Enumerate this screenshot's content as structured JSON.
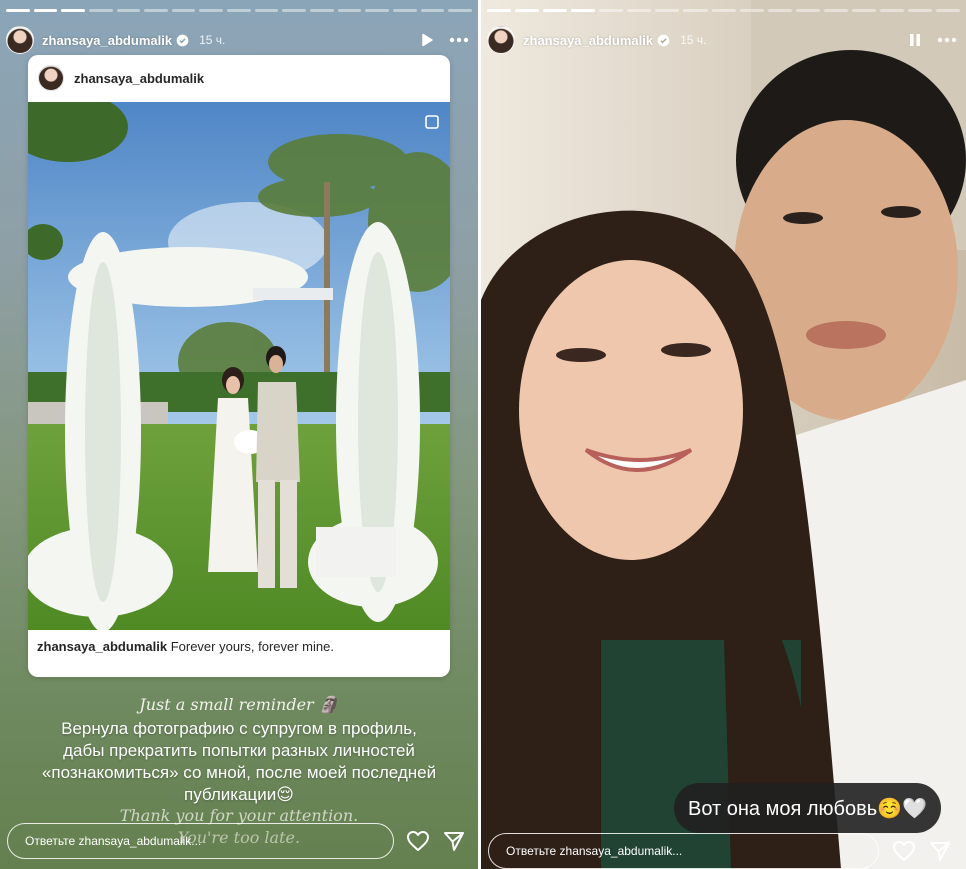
{
  "left_story": {
    "progress": {
      "segments": 17,
      "completed": 3
    },
    "header": {
      "username": "zhansaya_abdumalik",
      "time": "15 ч.",
      "play_icon": "play-icon",
      "more_icon": "more-icon"
    },
    "post": {
      "username": "zhansaya_abdumalik",
      "caption_username": "zhansaya_abdumalik",
      "caption_text": "Forever yours, forever mine."
    },
    "text": {
      "script_top": "Just a small reminder 🗿",
      "lines": [
        "Вернула фотографию с супругом в профиль,",
        "дабы прекратить попытки разных личностей",
        "«познакомиться» со мной, после моей последней",
        "публикации😌"
      ],
      "script_bottom_1": "Thank you for your attention.",
      "script_bottom_2": "You're too late."
    },
    "reply_placeholder": "Ответьте zhansaya_abdumalik..."
  },
  "right_story": {
    "progress": {
      "segments": 17,
      "completed": 4
    },
    "header": {
      "username": "zhansaya_abdumalik",
      "time": "15 ч.",
      "pause_icon": "pause-icon",
      "more_icon": "more-icon"
    },
    "sticker_text": "Вот она моя любовь☺️🤍",
    "reply_placeholder": "Ответьте zhansaya_abdumalik..."
  },
  "colors": {
    "verified": "#3897f0",
    "white": "#ffffff"
  }
}
